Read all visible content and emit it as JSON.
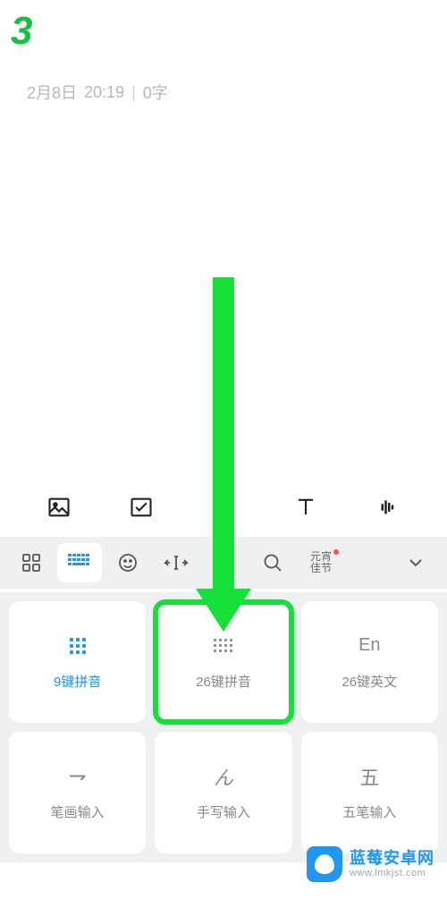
{
  "step_number": "3",
  "note": {
    "date": "2月8日",
    "time": "20:19",
    "word_count": "0字"
  },
  "action_bar": {
    "items": [
      "image",
      "checklist",
      "home",
      "text",
      "voice"
    ]
  },
  "keyboard_toolbar": {
    "items": [
      "apps",
      "keyboard-layout",
      "emoji",
      "cursor",
      "clipboard",
      "search"
    ],
    "festival_line1": "元宵",
    "festival_line2": "佳节",
    "collapse": "chevron-down"
  },
  "layouts": [
    {
      "icon": "nine-dots",
      "label": "9键拼音",
      "primary": true,
      "highlight": false
    },
    {
      "icon": "twelve-dots",
      "label": "26键拼音",
      "primary": false,
      "highlight": true
    },
    {
      "icon_text": "En",
      "label": "26键英文",
      "primary": false,
      "highlight": false
    },
    {
      "icon_text": "⇁",
      "label": "笔画输入",
      "primary": false,
      "highlight": false
    },
    {
      "icon_text": "ん",
      "label": "手写输入",
      "primary": false,
      "highlight": false
    },
    {
      "icon_text": "五",
      "label": "五笔输入",
      "primary": false,
      "highlight": false
    }
  ],
  "watermark": {
    "title": "蓝莓安卓网",
    "url": "www.lmkjst.com"
  }
}
